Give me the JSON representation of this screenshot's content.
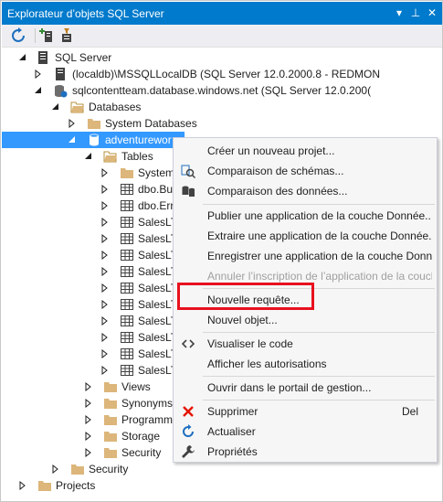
{
  "window": {
    "title": "Explorateur d’objets SQL Server",
    "dropdown_glyph": "▾",
    "pin_glyph": "⊥",
    "close_glyph": "✕"
  },
  "toolbar": {
    "refresh_icon": "refresh-icon",
    "add_server_icon": "add-server-icon",
    "filter_icon": "filter-icon"
  },
  "tree": {
    "sql_server": "SQL Server",
    "localdb": "(localdb)\\MSSQLLocalDB (SQL Server 12.0.2000.8 - REDMON",
    "remote": "sqlcontentteam.database.windows.net (SQL Server 12.0.200(",
    "databases": "Databases",
    "system_databases": "System Databases",
    "adventureworks": "adventurewor",
    "tables": "Tables",
    "table_items": [
      "System",
      "dbo.Bu",
      "dbo.Err",
      "SalesLT",
      "SalesLT",
      "SalesLT",
      "SalesLT",
      "SalesLT",
      "SalesLT",
      "SalesLT",
      "SalesLT",
      "SalesLT",
      "SalesLT"
    ],
    "views": "Views",
    "synonyms": "Synonyms",
    "programmability": "Programm",
    "storage": "Storage",
    "security_inner": "Security",
    "security": "Security",
    "projects": "Projects"
  },
  "context_menu": {
    "new_project": "Créer un nouveau projet...",
    "schema_compare": "Comparaison de schémas...",
    "data_compare": "Comparaison des données...",
    "publish_dac": "Publier une application de la couche Donnée...",
    "extract_dac": "Extraire une application de la couche Donnée...",
    "register_dac": "Enregistrer une application de la couche Donnée...",
    "unregister_dac": "Annuler l’inscription de l’application de la couche...",
    "new_query": "Nouvelle requête...",
    "new_object": "Nouvel objet...",
    "view_code": "Visualiser le code",
    "view_permissions": "Afficher les autorisations",
    "open_portal": "Ouvrir dans le portail de gestion...",
    "delete": "Supprimer",
    "delete_shortcut": "Del",
    "refresh": "Actualiser",
    "properties": "Propriétés"
  },
  "colors": {
    "title_bar": "#007acc",
    "selection": "#3399ff",
    "highlight_box": "#e8111f",
    "folder": "#dcb67a",
    "delete_icon": "#e51400"
  }
}
